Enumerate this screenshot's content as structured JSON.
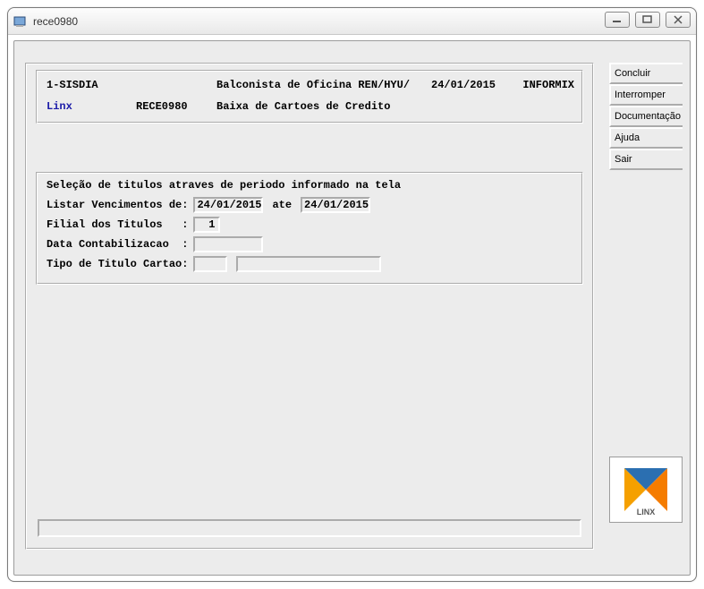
{
  "window": {
    "title": "rece0980"
  },
  "sidebar": {
    "buttons": [
      "Concluir",
      "Interromper",
      "Documentação",
      "Ajuda",
      "Sair"
    ]
  },
  "header": {
    "system": "1-SISDIA",
    "user_role": "Balconista de Oficina REN/HYU/",
    "date": "24/01/2015",
    "db": "INFORMIX",
    "company": "Linx",
    "program_code": "RECE0980",
    "program_title": "Baixa de Cartoes de Credito"
  },
  "form": {
    "group_label": "Seleção de titulos atraves de periodo informado na tela",
    "labels": {
      "venc_de": "Listar Vencimentos de:",
      "ate": "ate",
      "filial": "Filial dos Titulos   :",
      "data_cont": "Data Contabilizacao  :",
      "tipo": "Tipo de Titulo Cartao:"
    },
    "values": {
      "data_de": "24/01/2015",
      "data_ate": "24/01/2015",
      "filial": "1",
      "data_cont": "",
      "tipo_code": "",
      "tipo_desc": ""
    }
  },
  "logo_text": "LINX",
  "status": ""
}
